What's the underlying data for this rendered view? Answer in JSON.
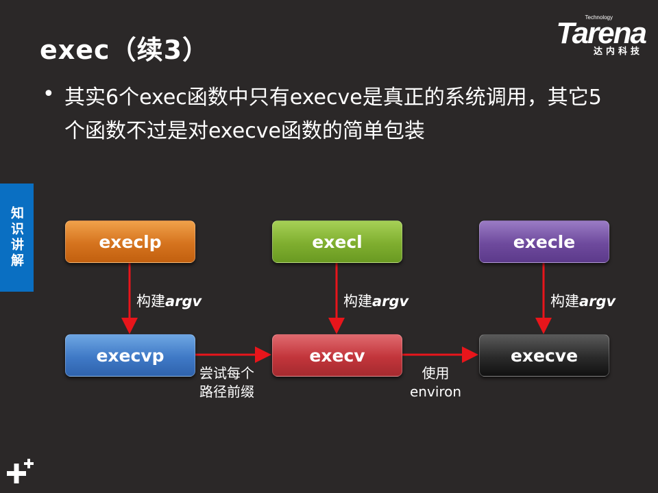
{
  "title": "exec（续3）",
  "logo": {
    "tech": "Technology",
    "brand": "Tarena",
    "cn": "达内科技"
  },
  "bullet": "•",
  "paragraph": "其实6个exec函数中只有execve是真正的系统调用，其它5个函数不过是对execve函数的简单包装",
  "side_tab": "知识讲解",
  "nodes": {
    "execlp": "execlp",
    "execl": "execl",
    "execle": "execle",
    "execvp": "execvp",
    "execv": "execv",
    "execve": "execve"
  },
  "edges": {
    "build_prefix": "构建",
    "build_arg": "argv",
    "try_prefix_line1": "尝试每个",
    "try_prefix_line2": "路径前缀",
    "use_line1": "使用",
    "use_line2": "environ"
  },
  "colors": {
    "background": "#2b2828",
    "arrow": "#e8151b",
    "side_tab": "#0a6fc2"
  }
}
